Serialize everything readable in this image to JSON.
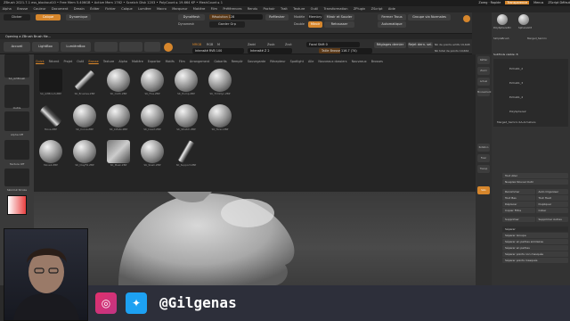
{
  "titlebar": {
    "text": "ZBrush 2021.7.1   ess_blockout10  •  Free Mem 5.406GB • Active Mem 1762 • Scratch Disk 1203 • PolyCount ▸ 19.664 KP • MeshCount ▸ 1"
  },
  "topright": {
    "items": [
      "Zoreg · Rapide",
      "Transparence",
      "Menus",
      "ZScript Défaut"
    ]
  },
  "menubar": {
    "items": [
      "Alpha",
      "Brosse",
      "Couleur",
      "Document",
      "Dessin",
      "Éditer",
      "Fichier",
      "Calque",
      "Lumière",
      "Macro",
      "Marqueur",
      "Matière",
      "Film",
      "Préférences",
      "Rendu",
      "Pochoir",
      "Trait",
      "Texture",
      "Outil",
      "Transformation",
      "ZPlugin",
      "ZScript",
      "Aide"
    ]
  },
  "toprow1": {
    "dicker": "Dicker",
    "layer": "Calque",
    "dynamique": "Dynamique",
    "dynamique_persp": "DynaMesh",
    "resolution": "Résolution 128",
    "remesh": "ReMesher",
    "modele": "Modèle",
    "mentry": "Membry",
    "miroir": "Miroir et Souder",
    "fermer": "Fermer Trous",
    "groupes": "Groupe via Normales",
    "dynamesh_label": "Dynamesh",
    "garder": "Garder Grp",
    "double": "Double",
    "miroir2": "Miroir",
    "rehausser": "Rehausser",
    "automatique": "Automatique"
  },
  "opening": {
    "text": "Opening a ZBrush Brush file..."
  },
  "toprow2": {
    "accueil": "Accueil",
    "lightbox": "LightBox",
    "lumiere": "LumièreBox",
    "mrgb": "MRGB",
    "rgb": "RGB",
    "m": "M",
    "zadd": "Zadd",
    "zsub": "Zsub",
    "zcut": "Zcut",
    "focal": "Focal Shift 0",
    "intensity": "Intensité RVB 100",
    "zintensity": "Intensité Z 2",
    "draw_size": "Taille Brosse 116.7 (74)",
    "dynamic": "Dynamique",
    "duree": "Durée 80",
    "reglages": "Réglages dernier",
    "rejet": "Rejet dern. sel.",
    "nb_points": "Nb de points actifs 19,648",
    "nb_total": "Nb total de points 19,664"
  },
  "leftshelf": {
    "items": [
      "SA_ArtBrush",
      "Outils",
      "Alpha Off",
      "Texture Off",
      "SkinOut Stroke"
    ]
  },
  "popup": {
    "tabs": [
      "Quick",
      "Récent",
      "Projet",
      "Outil",
      "Brosse",
      "Texture",
      "Alpha",
      "Matière",
      "Exportar",
      "Motifs",
      "Film",
      "Arrangement",
      "Gabarits",
      "Remplir",
      "Sauvegarde",
      "Récepteur",
      "Spotlight",
      "Alle",
      "Nouveaux dossiers",
      "Nouveaux",
      "Brosses"
    ],
    "active_tab": "Brosse",
    "brushes": [
      [
        "SA_ArtBrush.ZBP",
        "SK_Brushes.ZBP",
        "SK_Cloth.ZBP",
        "SK_Fine.ZBP",
        "SK_Hump.ZBP",
        "SK_TrimDyn.ZBP"
      ],
      [
        "Move.ZBP",
        "SK_Curve.ZBP",
        "SK_Inflate.ZBP",
        "SK_Insert.ZBP",
        "SK_Stretch.ZBP",
        "SK_Torso.ZBP"
      ],
      [
        "Move2.ZBP",
        "SK_ClayFill.ZBP",
        "SK_Mask.ZBP",
        "SK_Slash.ZBP",
        "SK_Support.ZBP",
        ""
      ]
    ]
  },
  "rightstrip": {
    "items": [
      "Défiler",
      "Zoom",
      "Actuel",
      "Mouvement",
      "Rotation",
      "Fixer",
      "Transp",
      "Solo"
    ]
  },
  "rightpanel": {
    "header": [
      "PolySphere3D",
      "Sphere4d3",
      "SimpleBrush",
      "Merged_Samrin"
    ],
    "subtools_label": "SubTools visible: 8",
    "subtools": [
      "Extra61_2",
      "Extra61_3",
      "Extra61_4",
      "PolySphere2",
      "Merged_Samrin-SA-Armature"
    ],
    "buttons": [
      "Tout Aller",
      "Nuaplex Nouvel Outil",
      "Renommer",
      "Auto Organiser",
      "Tout Bas",
      "Tout Haut",
      "Déplacer",
      "Dupliquer",
      "Copier Filtre",
      "Coller",
      "Supprimer",
      "Supprimer Autres",
      "Séparer",
      "Séparer Groupe",
      "Séparer en parties similaires",
      "Séparer en parties",
      "Séparer points non masqués",
      "Séparer points masqués"
    ]
  },
  "banner": {
    "handle": "@Gilgenas"
  },
  "colors": {
    "accent": "#d6862c",
    "bg": "#2a2a2a"
  }
}
